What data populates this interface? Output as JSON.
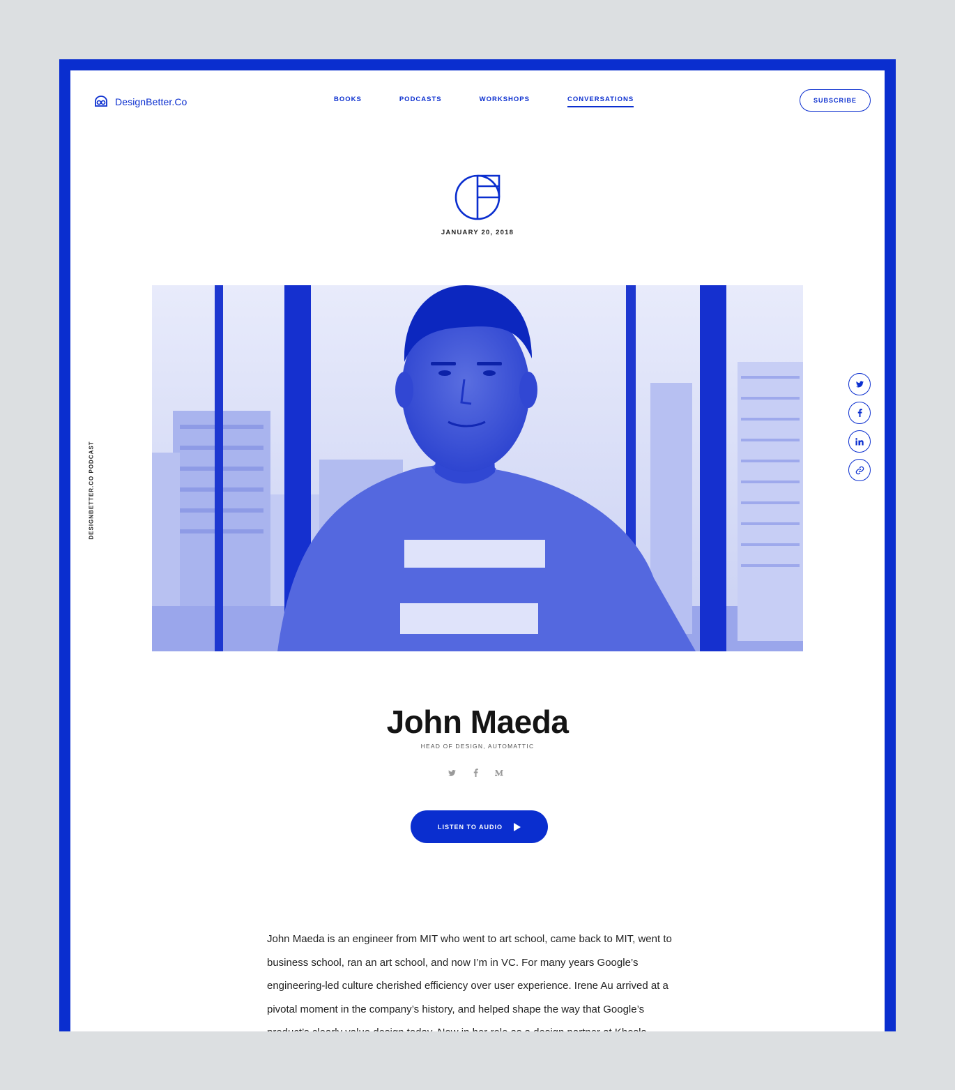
{
  "header": {
    "logo_text": "DesignBetter.Co",
    "nav": [
      {
        "label": "BOOKS",
        "active": false
      },
      {
        "label": "PODCASTS",
        "active": false
      },
      {
        "label": "WORKSHOPS",
        "active": false
      },
      {
        "label": "CONVERSATIONS",
        "active": true
      }
    ],
    "subscribe_label": "SUBSCRIBE"
  },
  "episode": {
    "date": "JANUARY 20, 2018",
    "side_label": "DESIGNBETTER.CO PODCAST"
  },
  "share": {
    "icons": [
      "twitter-icon",
      "facebook-icon",
      "linkedin-icon",
      "link-icon"
    ]
  },
  "guest": {
    "name": "John Maeda",
    "role": "HEAD OF DESIGN, AUTOMATTIC",
    "social_icons": [
      "twitter-icon",
      "facebook-icon",
      "medium-icon"
    ]
  },
  "listen_label": "LISTEN TO AUDIO",
  "body": "John Maeda is an engineer from MIT who went to art school, came back to MIT, went to business school, ran an art school, and now I’m in VC. For many years Google’s engineering-led culture cherished efficiency over user experience. Irene Au arrived at a pivotal moment in the company’s history, and helped shape the way that Google’s product’s clearly value design today. Now in her role as a design partner at Khosla",
  "colors": {
    "brand": "#0a2ecf",
    "background": "#dcdfe1",
    "text": "#141414"
  }
}
